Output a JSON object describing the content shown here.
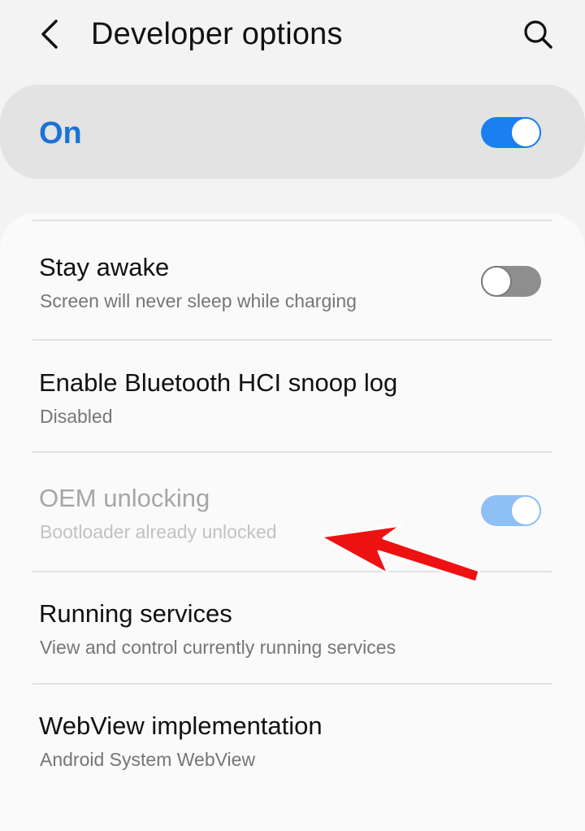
{
  "header": {
    "title": "Developer options",
    "back_icon": "chevron-left-icon",
    "search_icon": "search-icon"
  },
  "master": {
    "label": "On",
    "enabled": true
  },
  "items": [
    {
      "title": "Stay awake",
      "subtitle": "Screen will never sleep while charging",
      "toggle": "off"
    },
    {
      "title": "Enable Bluetooth HCI snoop log",
      "subtitle": "Disabled"
    },
    {
      "title": "OEM unlocking",
      "subtitle": "Bootloader already unlocked",
      "toggle": "on",
      "disabled": true
    },
    {
      "title": "Running services",
      "subtitle": "View and control currently running services"
    },
    {
      "title": "WebView implementation",
      "subtitle": "Android System WebView"
    }
  ],
  "colors": {
    "accent": "#1a7ff0",
    "accent_disabled": "#8ebff5",
    "on_label": "#1a73d6",
    "annotation_arrow": "#ee1111"
  }
}
